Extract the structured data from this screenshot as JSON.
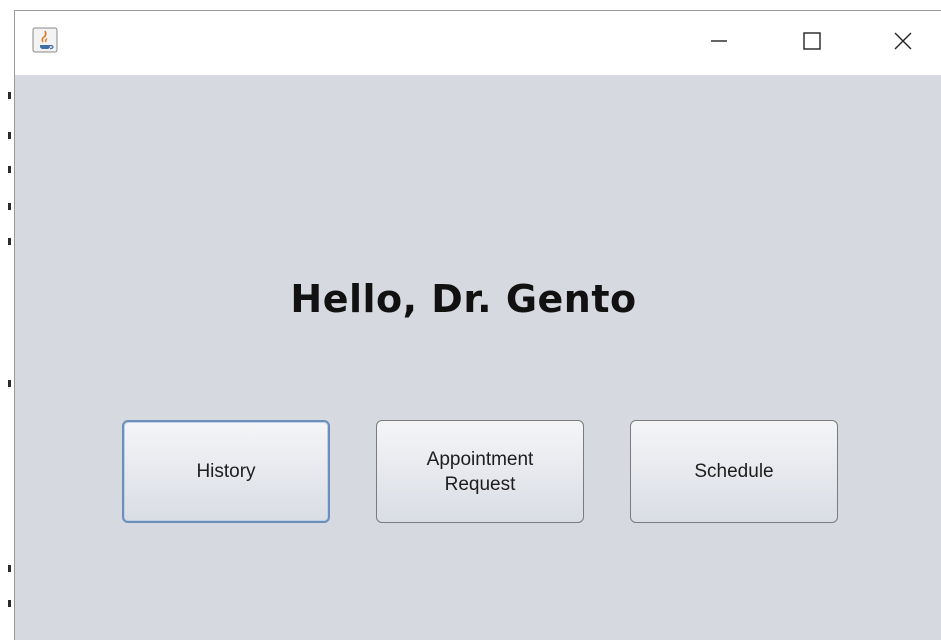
{
  "window": {
    "title": "",
    "icon": "java-cup-icon",
    "controls": {
      "minimize": "minimize",
      "maximize": "maximize",
      "close": "close"
    }
  },
  "main": {
    "greeting": "Hello, Dr. Gento",
    "buttons": [
      {
        "label": "History",
        "focused": true
      },
      {
        "label": "Appointment\nRequest",
        "focused": false
      },
      {
        "label": "Schedule",
        "focused": false
      }
    ]
  },
  "colors": {
    "background": "#d6d9e0",
    "titlebar": "#ffffff",
    "focus_border": "#6b8fb8"
  }
}
